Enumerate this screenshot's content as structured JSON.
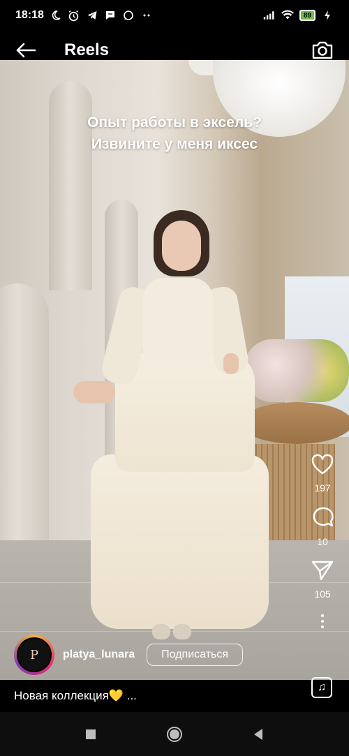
{
  "status_bar": {
    "time": "18:18",
    "battery": "89",
    "icons": [
      "moon-icon",
      "alarm-icon",
      "telegram-icon",
      "chat-icon",
      "whatsapp-icon",
      "more-dots-icon",
      "signal-icon",
      "wifi-icon",
      "battery-icon",
      "charging-icon"
    ]
  },
  "header": {
    "title": "Reels"
  },
  "video": {
    "overlay_line1": "Опыт работы в эксель?",
    "overlay_line2": "Извините у меня иксес"
  },
  "actions": {
    "likes": "197",
    "comments": "10",
    "shares": "105"
  },
  "author": {
    "avatar_text": "P",
    "username": "platya_lunara",
    "follow_label": "Подписаться"
  },
  "caption": {
    "text": "Новая коллекция💛 ..."
  },
  "colors": {
    "background": "#000000",
    "battery_fill": "#6ec04a",
    "avatar_ring": "#e1306c"
  }
}
